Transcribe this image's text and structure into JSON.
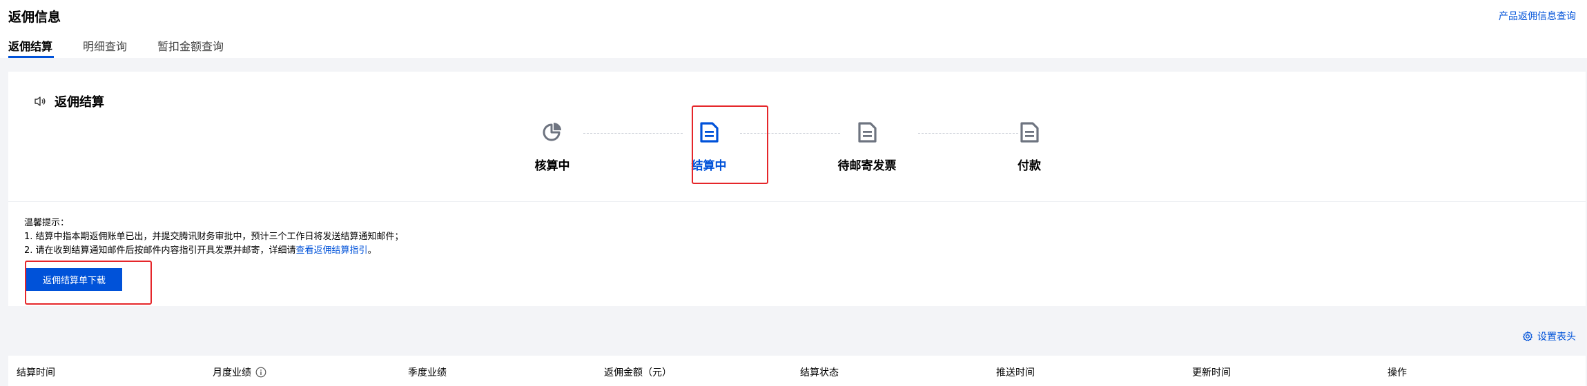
{
  "header": {
    "title": "返佣信息",
    "top_link": "产品返佣信息查询",
    "tabs": [
      {
        "label": "返佣结算",
        "active": true
      },
      {
        "label": "明细查询",
        "active": false
      },
      {
        "label": "暂扣金额查询",
        "active": false
      }
    ]
  },
  "settlement": {
    "title": "返佣结算",
    "title_icon": "speaker-icon",
    "steps": [
      {
        "label": "核算中",
        "icon": "pie-chart-icon",
        "active": false
      },
      {
        "label": "结算中",
        "icon": "document-icon",
        "active": true
      },
      {
        "label": "待邮寄发票",
        "icon": "document-icon",
        "active": false
      },
      {
        "label": "付款",
        "icon": "document-icon",
        "active": false
      }
    ],
    "tips": {
      "heading": "温馨提示：",
      "line1": "1. 结算中指本期返佣账单已出，并提交腾讯财务审批中，预计三个工作日将发送结算通知邮件；",
      "line2_prefix": "2. 请在收到结算通知邮件后按邮件内容指引开具发票并邮寄，详细请",
      "line2_link": "查看返佣结算指引",
      "line2_suffix": "。"
    },
    "download_button": "返佣结算单下载"
  },
  "table": {
    "settings_label": "设置表头",
    "columns": [
      "结算时间",
      "月度业绩",
      "季度业绩",
      "返佣金额（元）",
      "结算状态",
      "推送时间",
      "更新时间",
      "操作"
    ]
  },
  "colors": {
    "accent": "#0052d9",
    "highlight": "#e5262a",
    "icon_gray": "#6e7480"
  }
}
